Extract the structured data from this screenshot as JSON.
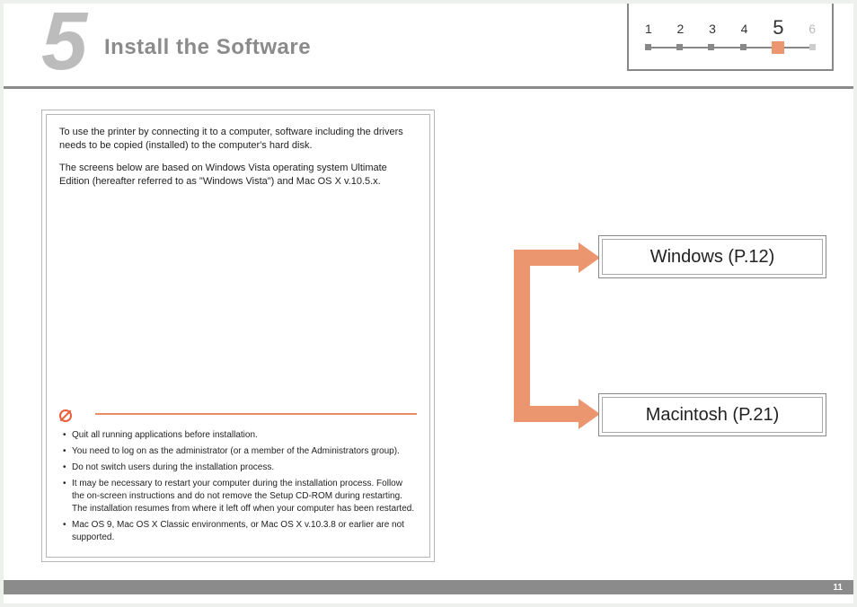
{
  "chapter": {
    "number": "5",
    "title": "Install the Software"
  },
  "steps": {
    "items": [
      "1",
      "2",
      "3",
      "4",
      "5",
      "6"
    ],
    "current_index": 4
  },
  "intro": {
    "p1": "To use the printer by connecting it to a computer, software including the drivers needs to be copied (installed) to the computer's hard disk.",
    "p2": "The screens below are based on Windows Vista operating system Ultimate Edition (hereafter referred to as \"Windows Vista\") and Mac OS X v.10.5.x."
  },
  "warnings": [
    "Quit all running applications before installation.",
    "You need to log on as the administrator (or a member of the Administrators group).",
    "Do not switch users during the installation process.",
    "It may be necessary to restart your computer during the installation process. Follow the on-screen instructions and do not remove the Setup CD-ROM during restarting. The installation resumes from where it left off when your computer has been restarted.",
    "Mac OS 9, Mac OS X Classic environments, or Mac OS X v.10.3.8 or earlier are not supported."
  ],
  "targets": {
    "windows": "Windows (P.12)",
    "macintosh": "Macintosh (P.21)"
  },
  "page_number": "11",
  "colors": {
    "accent": "#ec9670",
    "gray": "#8b8b8b"
  }
}
